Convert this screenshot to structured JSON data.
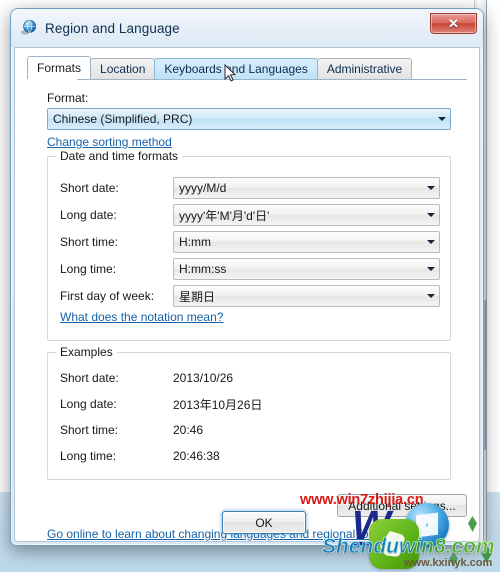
{
  "window": {
    "title": "Region and Language",
    "icon": "globe-icon",
    "close_label": "✕"
  },
  "tabs": [
    {
      "label": "Formats",
      "state": "selected"
    },
    {
      "label": "Location",
      "state": "normal"
    },
    {
      "label": "Keyboards and Languages",
      "state": "hover"
    },
    {
      "label": "Administrative",
      "state": "normal"
    }
  ],
  "format_section": {
    "label": "Format:",
    "selected": "Chinese (Simplified, PRC)",
    "sorting_link": "Change sorting method"
  },
  "datetime_group": {
    "title": "Date and time formats",
    "rows": [
      {
        "label": "Short date:",
        "value": "yyyy/M/d"
      },
      {
        "label": "Long date:",
        "value": "yyyy'年'M'月'd'日'"
      },
      {
        "label": "Short time:",
        "value": "H:mm"
      },
      {
        "label": "Long time:",
        "value": "H:mm:ss"
      },
      {
        "label": "First day of week:",
        "value": "星期日"
      }
    ],
    "notation_link": "What does the notation mean?"
  },
  "examples_group": {
    "title": "Examples",
    "rows": [
      {
        "label": "Short date:",
        "value": "2013/10/26"
      },
      {
        "label": "Long date:",
        "value": "2013年10月26日"
      },
      {
        "label": "Short time:",
        "value": "20:46"
      },
      {
        "label": "Long time:",
        "value": "20:46:38"
      }
    ]
  },
  "footer": {
    "additional_settings": "Additional settings...",
    "go_online_link": "Go online to learn about changing languages and regional formats",
    "ok_button": "OK"
  },
  "watermarks": {
    "url_top": "www.win7zhijia.cn",
    "logo_text": "W",
    "brand": "Shenduwin8.com",
    "url_bottom": "www.kxinyk.com"
  },
  "colors": {
    "accent_blue": "#1562a8",
    "close_red": "#c64436",
    "tab_hover": "#bfe3f8",
    "watermark_red": "#d81a12",
    "watermark_blue": "#1b2a8a",
    "watermark_green": "#5cb215"
  }
}
